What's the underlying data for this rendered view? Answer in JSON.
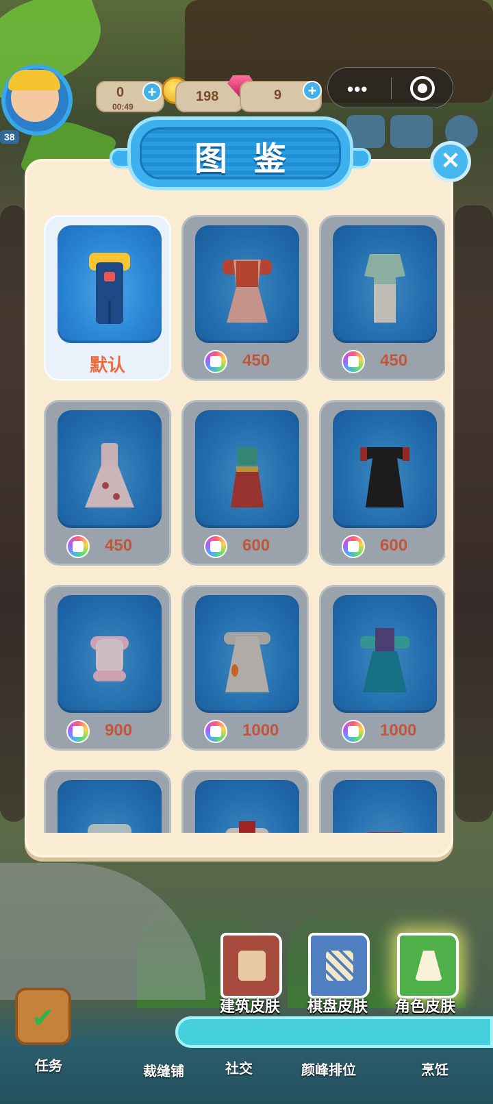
{
  "hud": {
    "energy_value": "0",
    "energy_timer": "00:49",
    "coins_value": "198",
    "gems_value": "9",
    "player_level": "38"
  },
  "panel": {
    "title": "图鉴",
    "close_icon": "close-icon"
  },
  "outfits": [
    {
      "label": "默认",
      "price": null,
      "selected": true
    },
    {
      "label": null,
      "price": "450",
      "selected": false
    },
    {
      "label": null,
      "price": "450",
      "selected": false
    },
    {
      "label": null,
      "price": "450",
      "selected": false
    },
    {
      "label": null,
      "price": "600",
      "selected": false
    },
    {
      "label": null,
      "price": "600",
      "selected": false
    },
    {
      "label": null,
      "price": "900",
      "selected": false
    },
    {
      "label": null,
      "price": "1000",
      "selected": false
    },
    {
      "label": null,
      "price": "1000",
      "selected": false
    }
  ],
  "outfit_labels": {
    "default": "默认",
    "p1": "450",
    "p2": "450",
    "p3": "450",
    "p4": "600",
    "p5": "600",
    "p6": "900",
    "p7": "1000",
    "p8": "1000"
  },
  "category_tabs": {
    "building_skin": "建筑皮肤",
    "board_skin": "棋盘皮肤",
    "character_skin": "角色皮肤"
  },
  "bottom_nav": {
    "tasks": "任务",
    "tailor_shop": "裁缝铺",
    "social": "社交",
    "ranking": "颜峰排位",
    "cooking": "烹饪"
  },
  "colors": {
    "accent_blue": "#3cb1ee",
    "price_text": "#c2563a",
    "default_label": "#f06a3c",
    "panel_bg": "#f9ecd2"
  }
}
